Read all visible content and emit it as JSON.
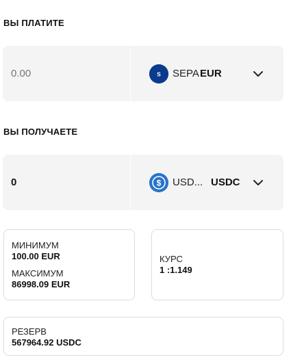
{
  "pay": {
    "section_label": "ВЫ ПЛАТИТЕ",
    "amount_placeholder": "0.00",
    "icon": "sepa-icon",
    "icon_text": "SEPA",
    "network": "SEPA",
    "currency": "EUR"
  },
  "receive": {
    "section_label": "ВЫ ПОЛУЧАЕТЕ",
    "amount_value": "0",
    "icon": "usdc-icon",
    "network": "USD...",
    "currency": "USDC"
  },
  "limits": {
    "min_label": "МИНИМУМ",
    "min_value": "100.00 EUR",
    "max_label": "МАКСИМУМ",
    "max_value": "86998.09 EUR"
  },
  "rate": {
    "label": "КУРС",
    "value": "1 :1.149"
  },
  "reserve": {
    "label": "РЕЗЕРВ",
    "value": "567964.92 USDC"
  },
  "colors": {
    "sepa_icon_bg": "#0a3b8c",
    "usdc_icon_bg": "#2775ca",
    "panel_bg": "#f4f4f4",
    "card_border": "#dcdcdc"
  }
}
